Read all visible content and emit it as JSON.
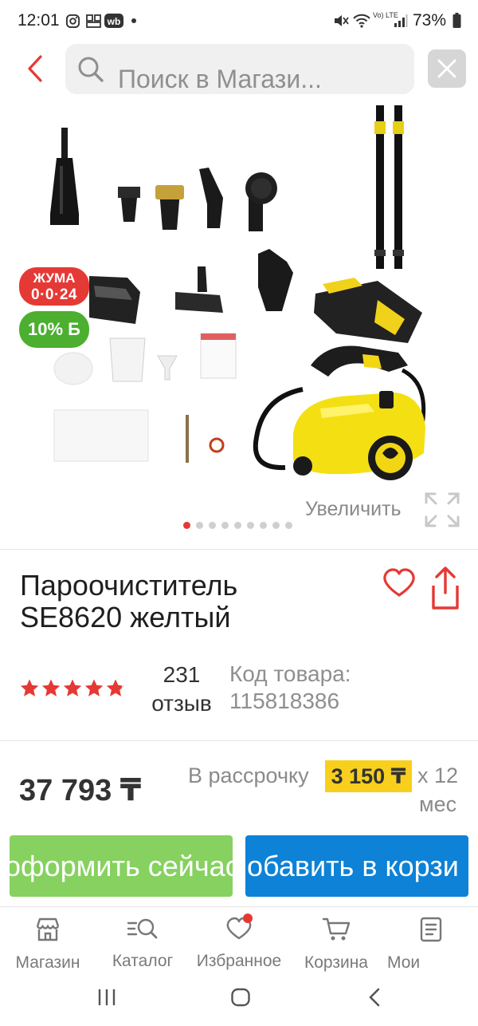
{
  "status_bar": {
    "time": "12:01",
    "battery": "73%",
    "app_badge": "wb",
    "network": "Vo) LTE"
  },
  "search": {
    "placeholder": "Поиск в Магази..."
  },
  "gallery": {
    "badge_promo_line1": "ЖУМА",
    "badge_promo_line2": "0·0·24",
    "badge_discount": "10% Б",
    "zoom_label": "Увеличить",
    "slides_total": 9,
    "active_slide": 1
  },
  "product": {
    "title_line1": "Пароочиститель",
    "title_line2": "SE8620 желтый",
    "rating": 4.8,
    "reviews_count": "231",
    "reviews_label": "отзыв",
    "sku_label": "Код товара:",
    "sku": "115818386"
  },
  "price": {
    "value": "37 793 ₸",
    "installment_label": "В рассрочку",
    "installment_amount": "3 150 ₸",
    "installment_x": "х 12",
    "installment_months": "мес"
  },
  "actions": {
    "buy_now": "оформить сейчас",
    "add_to_cart": "обавить в корзи"
  },
  "bottom_nav": {
    "items": [
      {
        "label": "Магазин",
        "icon": "store-icon"
      },
      {
        "label": "Каталог",
        "icon": "catalog-search-icon"
      },
      {
        "label": "Избранное",
        "icon": "heart-icon"
      },
      {
        "label": "Корзина",
        "icon": "cart-icon"
      },
      {
        "label": "Мои",
        "icon": "orders-icon"
      }
    ]
  },
  "colors": {
    "accent_red": "#e53935",
    "buy_green": "#86d15f",
    "cart_blue": "#0d82d6",
    "installment_yellow": "#f8cf1c"
  }
}
